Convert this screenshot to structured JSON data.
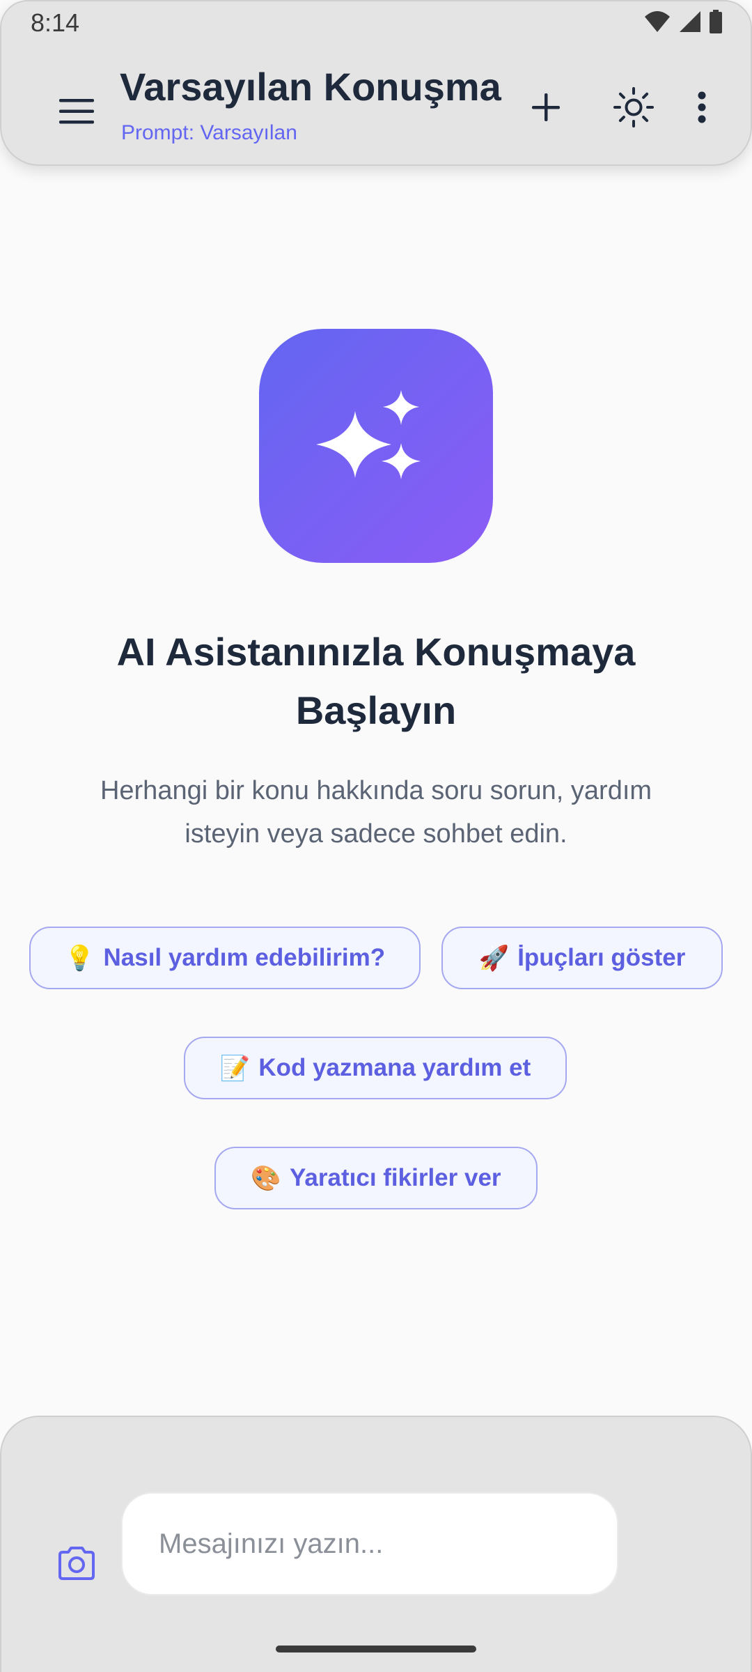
{
  "status_bar": {
    "time": "8:14"
  },
  "app_bar": {
    "title": "Varsayılan Konuşma",
    "subtitle": "Prompt: Varsayılan"
  },
  "hero": {
    "title_line1": "AI Asistanınızla Konuşmaya",
    "title_line2": "Başlayın",
    "description_line1": "Herhangi bir konu hakkında soru sorun, yardım",
    "description_line2": "isteyin veya sadece sohbet edin."
  },
  "suggestions": [
    {
      "emoji": "💡",
      "label": "Nasıl yardım edebilirim?"
    },
    {
      "emoji": "🚀",
      "label": "İpuçları göster"
    },
    {
      "emoji": "📝",
      "label": "Kod yazmana yardım et"
    },
    {
      "emoji": "🎨",
      "label": "Yaratıcı fikirler ver"
    }
  ],
  "composer": {
    "placeholder": "Mesajınızı yazın..."
  },
  "colors": {
    "accent": "#6366f1",
    "accent_end": "#8b5cf6",
    "chip_text": "#5b5fe0",
    "bar_bg": "#e4e4e4"
  },
  "icons": {
    "menu": "menu-icon",
    "add": "plus-icon",
    "theme": "sun-icon",
    "more": "more-vert-icon",
    "hero": "sparkles-icon",
    "camera": "camera-icon"
  }
}
